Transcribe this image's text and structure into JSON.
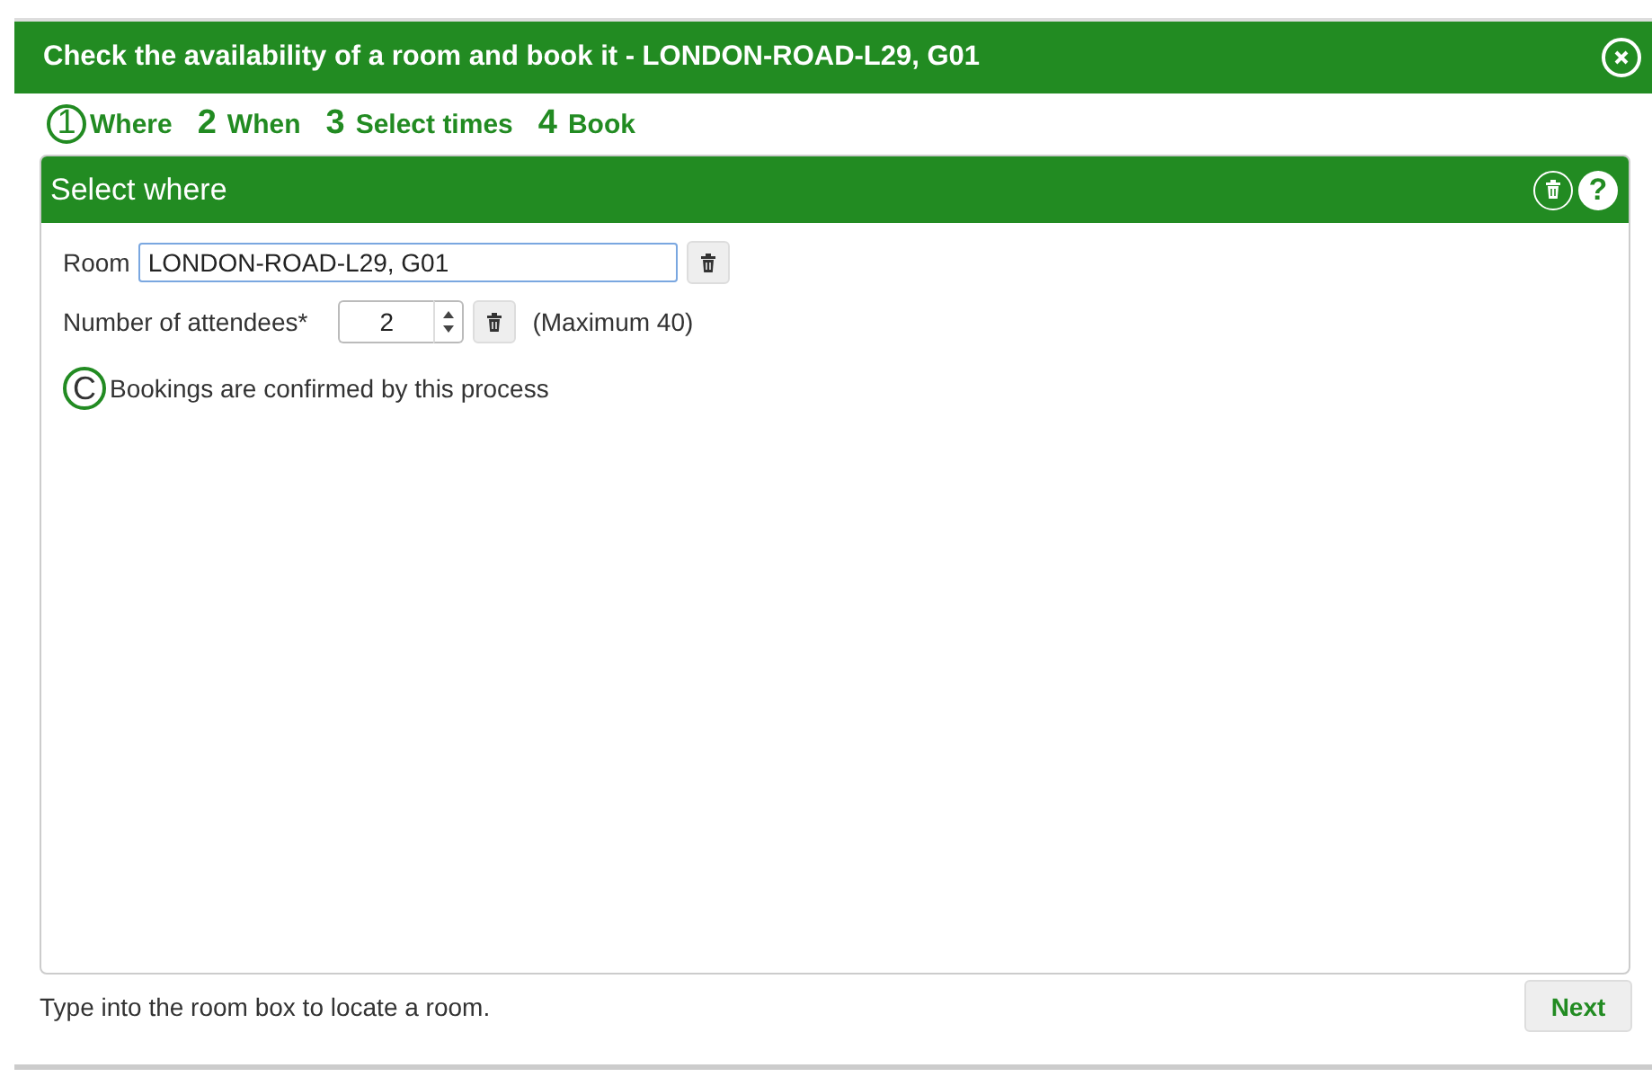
{
  "window": {
    "title": "Check the availability of a room and book it - LONDON-ROAD-L29, G01"
  },
  "steps": [
    {
      "number": "1",
      "label": "Where",
      "selected": true
    },
    {
      "number": "2",
      "label": "When",
      "selected": false
    },
    {
      "number": "3",
      "label": "Select times",
      "selected": false
    },
    {
      "number": "4",
      "label": "Book",
      "selected": false
    }
  ],
  "panel": {
    "title": "Select where",
    "help": "?",
    "room": {
      "label": "Room",
      "value": "LONDON-ROAD-L29, G01"
    },
    "attendees": {
      "label": "Number of attendees*",
      "value": "2",
      "hint": "(Maximum 40)"
    },
    "note": {
      "badge": "C",
      "text": "Bookings are confirmed by this process"
    }
  },
  "status_text": "Type into the room box to locate a room.",
  "buttons": [
    "Next"
  ]
}
